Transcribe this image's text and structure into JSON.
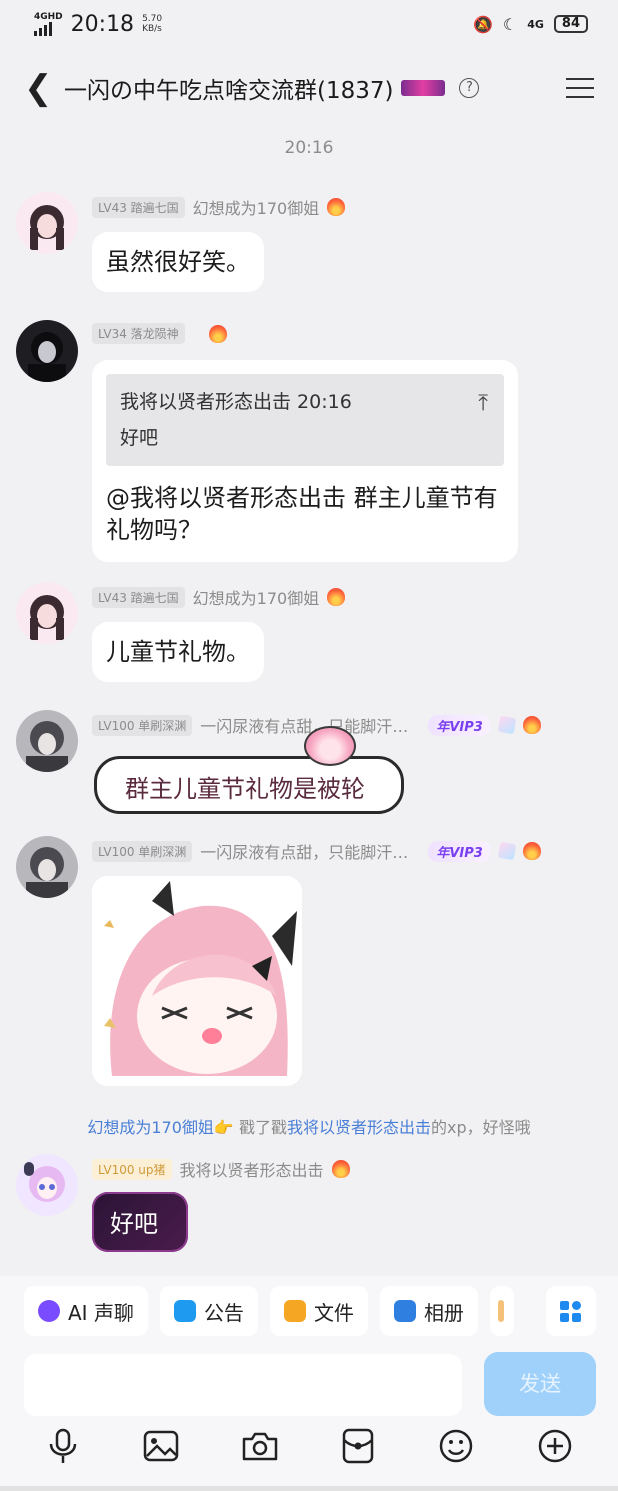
{
  "status_bar": {
    "network": "4GHD",
    "time": "20:18",
    "speed": "5.70",
    "speed_unit": "KB/s",
    "signal_right": "4G",
    "battery": "84"
  },
  "header": {
    "title": "一闪の中午吃点啥交流群(1837)"
  },
  "chat": {
    "timestamp": "20:16",
    "messages": [
      {
        "level": "LV43 踏遍七国",
        "name": "幻想成为170御姐",
        "text": "虽然很好笑。"
      },
      {
        "level": "LV34 落龙陨神",
        "name": "",
        "quote_title": "我将以贤者形态出击 20:16",
        "quote_text": "好吧",
        "text": "@我将以贤者形态出击 群主儿童节有礼物吗？"
      },
      {
        "level": "LV43 踏遍七国",
        "name": "幻想成为170御姐",
        "text": "儿童节礼物。"
      },
      {
        "level": "LV100 单刷深渊",
        "name": "一闪尿液有点甜，只能脚汗…",
        "vip": "年VIP3",
        "text": "群主儿童节礼物是被轮"
      },
      {
        "level": "LV100 单刷深渊",
        "name": "一闪尿液有点甜，只能脚汗…",
        "vip": "年VIP3"
      },
      {
        "level": "LV100 up猪",
        "name": "我将以贤者形态出击",
        "text": "好吧"
      }
    ],
    "system_notice": {
      "actor": "幻想成为170御姐",
      "action": "戳了戳",
      "target": "我将以贤者形态出击",
      "suffix": "的xp，好怪哦"
    }
  },
  "toolbar": {
    "chips": [
      {
        "label": "AI 声聊",
        "icon": "ai-voice-icon",
        "color": "#7a4cff"
      },
      {
        "label": "公告",
        "icon": "announcement-icon",
        "color": "#1e9bf0"
      },
      {
        "label": "文件",
        "icon": "folder-icon",
        "color": "#f5a623"
      },
      {
        "label": "相册",
        "icon": "album-icon",
        "color": "#2f7fe0"
      }
    ],
    "send_label": "发送"
  }
}
